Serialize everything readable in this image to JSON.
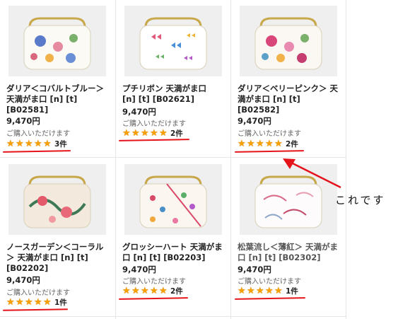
{
  "products": [
    {
      "name": "ダリア＜コバルトブルー＞\n天満がま口 [n] [t]\n[B02581]",
      "price": "9,470円",
      "availability": "ご購入いただけます",
      "rating": 5,
      "review_count": "3件"
    },
    {
      "name": "プチリボン 天満がま口\n[n] [t] [B02621]",
      "price": "9,470円",
      "availability": "ご購入いただけます",
      "rating": 5,
      "review_count": "2件"
    },
    {
      "name": "ダリア＜ベリーピンク＞ 天\n満がま口 [n] [t]\n[B02582]",
      "price": "9,470円",
      "availability": "ご購入いただけます",
      "rating": 5,
      "review_count": "2件"
    },
    {
      "name": "ノースガーデン＜コーラル\n＞ 天満がま口 [n] [t]\n[B02202]",
      "price": "9,470円",
      "availability": "ご購入いただけます",
      "rating": 5,
      "review_count": "1件"
    },
    {
      "name": "グロッシーハート 天満がま\n口 [n] [t] [B02203]",
      "price": "9,470円",
      "availability": "ご購入いただけます",
      "rating": 5,
      "review_count": "2件"
    },
    {
      "name": "松葉流し＜薄紅＞ 天満がま\n口 [n] [t] [B02302]",
      "price": "9,470円",
      "availability": "ご購入いただけます",
      "rating": 5,
      "review_count": "1件"
    }
  ],
  "annotation": {
    "text": "これです",
    "color": "#e5141b"
  },
  "colors": {
    "star": "#f7a000",
    "highlight": "#e5141b"
  }
}
